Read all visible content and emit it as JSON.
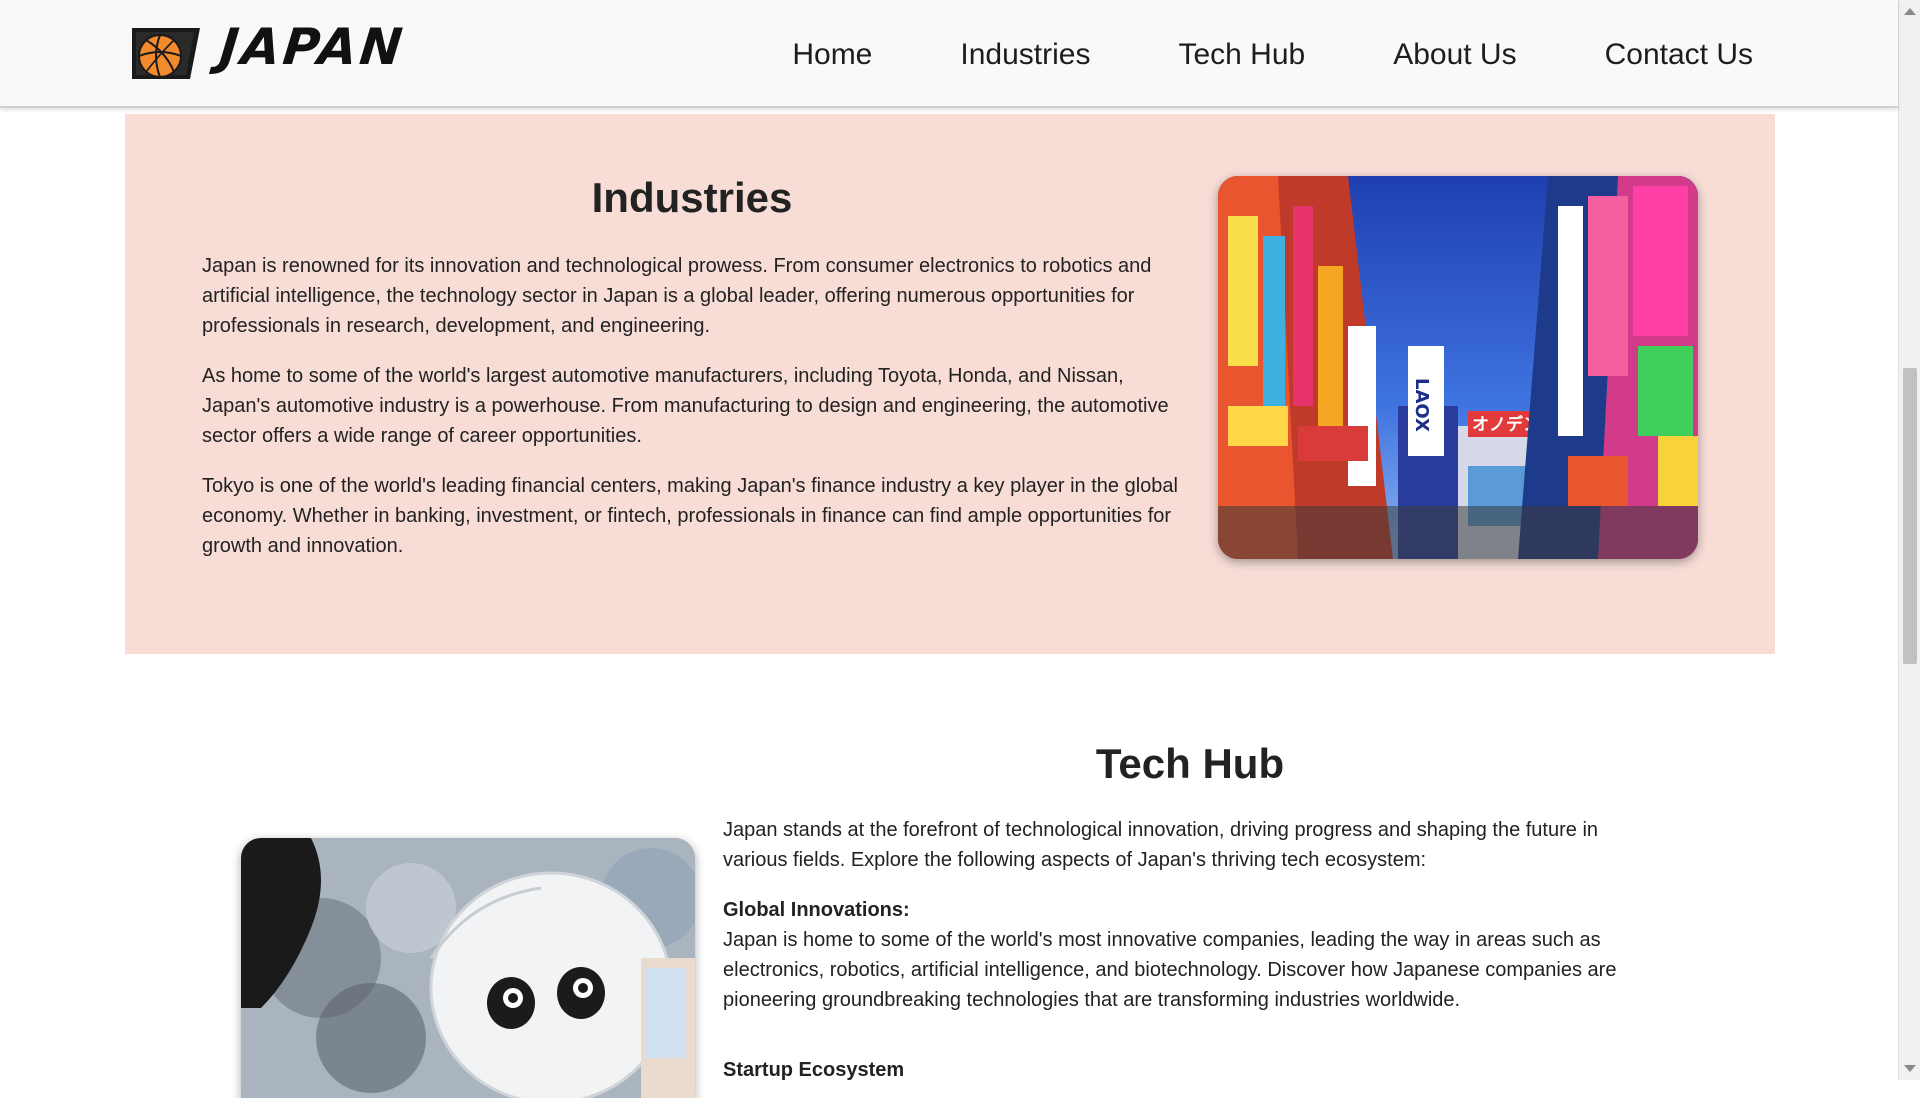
{
  "brand": {
    "name": "JAPAN",
    "logo_icon": "basketball-logo-icon"
  },
  "nav": {
    "items": [
      {
        "label": "Home"
      },
      {
        "label": "Industries"
      },
      {
        "label": "Tech Hub"
      },
      {
        "label": "About Us"
      },
      {
        "label": "Contact Us"
      }
    ]
  },
  "industries": {
    "title": "Industries",
    "background_color": "#f8ddd7",
    "paragraphs": [
      "Japan is renowned for its innovation and technological prowess. From consumer electronics to robotics and artificial intelligence, the technology sector in Japan is a global leader, offering numerous opportunities for professionals in research, development, and engineering.",
      "As home to some of the world's largest automotive manufacturers, including Toyota, Honda, and Nissan, Japan's automotive industry is a powerhouse. From manufacturing to design and engineering, the automotive sector offers a wide range of career opportunities.",
      "Tokyo is one of the world's leading financial centers, making Japan's finance industry a key player in the global economy. Whether in banking, investment, or fintech, professionals in finance can find ample opportunities for growth and innovation."
    ],
    "image_sign_text": [
      "LAOX",
      "オノデン"
    ]
  },
  "techhub": {
    "title": "Tech Hub",
    "intro": "Japan stands at the forefront of technological innovation, driving progress and shaping the future in various fields. Explore the following aspects of Japan's thriving tech ecosystem:",
    "sections": [
      {
        "heading": "Global Innovations:",
        "text": "Japan is home to some of the world's most innovative companies, leading the way in areas such as electronics, robotics, artificial intelligence, and biotechnology. Discover how Japanese companies are pioneering groundbreaking technologies that are transforming industries worldwide."
      },
      {
        "heading": "Startup Ecosystem",
        "text": ""
      }
    ]
  },
  "colors": {
    "navbar_bg": "#f8f9fa",
    "text": "#212529"
  }
}
